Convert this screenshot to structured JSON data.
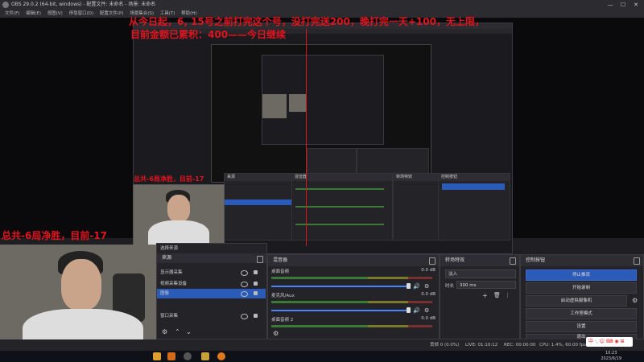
{
  "window": {
    "title": "OBS 29.0.2 (64-bit, windows) - 配置文件: 未命名 - 场景: 未命名"
  },
  "menu": [
    "文件(F)",
    "编辑(E)",
    "视图(V)",
    "停靠窗口(D)",
    "配置文件(P)",
    "场景集合(S)",
    "工具(T)",
    "帮助(H)"
  ],
  "overlay": {
    "line1": "从今日起，6, 15号之前打完这个号，没打完送200，晚打完一天+100，无上限，",
    "line2": "目前金额已累积：400——今日继续",
    "webcam_record": "总共-6局净胜，目前-17",
    "main_record": "总共-6局净胜，目前-17"
  },
  "sources": {
    "title": "来源",
    "top_label": "选择来源",
    "items": [
      {
        "label": "显示器采集",
        "selected": false
      },
      {
        "label": "视频采集设备",
        "selected": false
      },
      {
        "label": "图像",
        "selected": true
      },
      {
        "label": "窗口采集",
        "selected": false
      }
    ]
  },
  "mixer": {
    "title": "混音器",
    "channels": [
      {
        "name": "桌面音频",
        "db": "0.0 dB"
      },
      {
        "name": "麦克风/Aux",
        "db": "0.0 dB"
      },
      {
        "name": "桌面音频 2",
        "db": "0.0 dB"
      }
    ],
    "ticks": [
      "-60",
      "-55",
      "-50",
      "-45",
      "-40",
      "-35",
      "-30",
      "-25",
      "-20",
      "-15",
      "-10",
      "-5",
      "0"
    ]
  },
  "transitions": {
    "title": "转场特效",
    "type": "淡入",
    "duration_label": "时长",
    "duration": "300 ms"
  },
  "controls": {
    "title": "控制按钮",
    "buttons": [
      "停止推流",
      "开始录制",
      "启动虚拟摄像机",
      "工作室模式",
      "设置",
      "退出"
    ]
  },
  "status": {
    "frames": "丢帧 0 (0.0%)",
    "live": "LIVE: 01:10:12",
    "rec": "REC: 00:00:00",
    "cpu": "CPU: 1.4%, 60.00 fps",
    "kbps": "kb/s: 3962"
  },
  "taskbar": {
    "time": "10:23",
    "date": "2023/6/19"
  },
  "ime": {
    "label": "中 ·, ☺ ⌨ ◉ ⊞"
  },
  "colors": {
    "accent": "#2b5bb8",
    "overlay_red": "#e0141e"
  }
}
